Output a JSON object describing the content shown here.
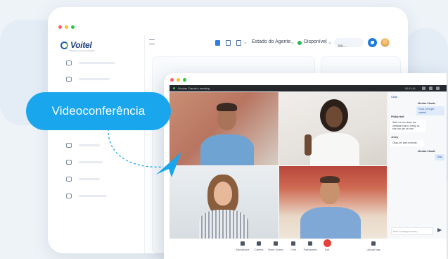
{
  "brand": {
    "name": "Voitel",
    "tagline": "Soluções em Comunicação"
  },
  "toolbar": {
    "agent_state": "Estado do Agente",
    "availability": "Disponível",
    "search_placeholder": "Bu..."
  },
  "callout": {
    "label": "Videoconferência"
  },
  "meeting": {
    "title": "Nicolas Claude's meeting",
    "clock": "00:11:41",
    "chat": {
      "title": "Chat",
      "messages": [
        {
          "name": "Nicolas Claude",
          "text": "Hi all, Let's get started!",
          "side": "right"
        },
        {
          "name": "Phillip Huff",
          "text": "Wait. Let me share the invitation link to Jenny, so she can join us now.",
          "side": "left"
        },
        {
          "name": "Jenny",
          "text": "Okay, let' wait a minute.",
          "side": "left"
        },
        {
          "name": "Nicolas Claude",
          "text": "Okay",
          "side": "right"
        }
      ],
      "input_placeholder": "Send a message to Jenny"
    },
    "controls": [
      "Microphone",
      "Camera",
      "Share Screen",
      "Chat",
      "Participants",
      "Exit"
    ],
    "upload": "Upload logs"
  },
  "colors": {
    "accent": "#1aa6ec",
    "brand": "#1d3f7a",
    "status": "#2db84d",
    "exit": "#e8413b"
  }
}
